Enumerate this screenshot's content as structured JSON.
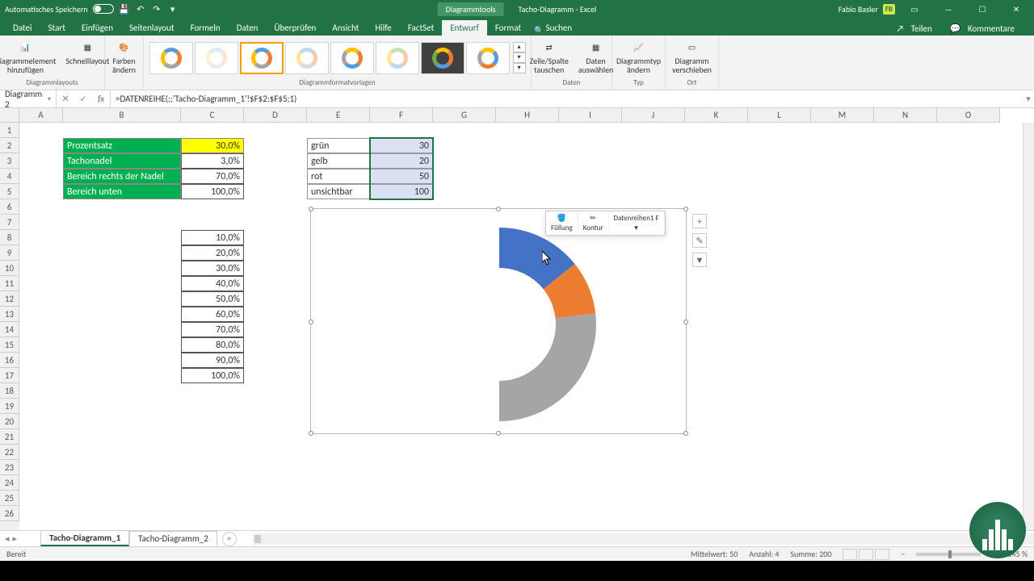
{
  "title_bar": {
    "autosave_label": "Automatisches Speichern",
    "tool_context": "Diagrammtools",
    "doc_name": "Tacho-Diagramm",
    "app_name": "Excel",
    "user": "Fabio Basler",
    "user_initials": "FB"
  },
  "tabs": {
    "datei": "Datei",
    "start": "Start",
    "einfuegen": "Einfügen",
    "seitenlayout": "Seitenlayout",
    "formeln": "Formeln",
    "daten": "Daten",
    "ueberpruefen": "Überprüfen",
    "ansicht": "Ansicht",
    "hilfe": "Hilfe",
    "factset": "FactSet",
    "entwurf": "Entwurf",
    "format": "Format",
    "suchen": "Suchen",
    "teilen": "Teilen",
    "kommentare": "Kommentare"
  },
  "ribbon": {
    "add_element": "Diagrammelement hinzufügen",
    "schnelllayout": "Schnelllayout",
    "layouts_label": "Diagrammlayouts",
    "farben": "Farben ändern",
    "styles_label": "Diagrammformatvorlagen",
    "zeile_spalte": "Zeile/Spalte tauschen",
    "daten_auswaehlen": "Daten auswählen",
    "daten_label": "Daten",
    "typ_aendern": "Diagrammtyp ändern",
    "typ_label": "Typ",
    "verschieben": "Diagramm verschieben",
    "ort_label": "Ort"
  },
  "fbar": {
    "name": "Diagramm 2",
    "formula": "=DATENREIHE(;;'Tacho-Diagramm_1'!$F$2:$F$5;1)"
  },
  "columns": [
    "A",
    "B",
    "C",
    "D",
    "E",
    "F",
    "G",
    "H",
    "I",
    "J",
    "K",
    "L",
    "M",
    "N",
    "O"
  ],
  "table1": {
    "r0": {
      "label": "Prozentsatz",
      "val": "30,0%"
    },
    "r1": {
      "label": "Tachonadel",
      "val": "3,0%"
    },
    "r2": {
      "label": "Bereich rechts der Nadel",
      "val": "70,0%"
    },
    "r3": {
      "label": "Bereich unten",
      "val": "100,0%"
    }
  },
  "table2": {
    "r0": {
      "label": "grün",
      "val": "30"
    },
    "r1": {
      "label": "gelb",
      "val": "20"
    },
    "r2": {
      "label": "rot",
      "val": "50"
    },
    "r3": {
      "label": "unsichtbar",
      "val": "100"
    }
  },
  "list": [
    "10,0%",
    "20,0%",
    "30,0%",
    "40,0%",
    "50,0%",
    "60,0%",
    "70,0%",
    "80,0%",
    "90,0%",
    "100,0%"
  ],
  "chart_data": {
    "type": "pie",
    "categories": [
      "grün",
      "gelb",
      "rot",
      "unsichtbar"
    ],
    "values": [
      30,
      20,
      50,
      100
    ],
    "title": "",
    "note": "doughnut chart, rotated; invisible segment hidden"
  },
  "mini_tb": {
    "fill": "Füllung",
    "outline": "Kontur",
    "series": "Datenreihen1 F"
  },
  "sheets": {
    "s1": "Tacho-Diagramm_1",
    "s2": "Tacho-Diagramm_2"
  },
  "status": {
    "ready": "Bereit",
    "avg": "Mittelwert: 50",
    "count": "Anzahl: 4",
    "sum": "Summe: 200",
    "zoom": "145 %"
  }
}
